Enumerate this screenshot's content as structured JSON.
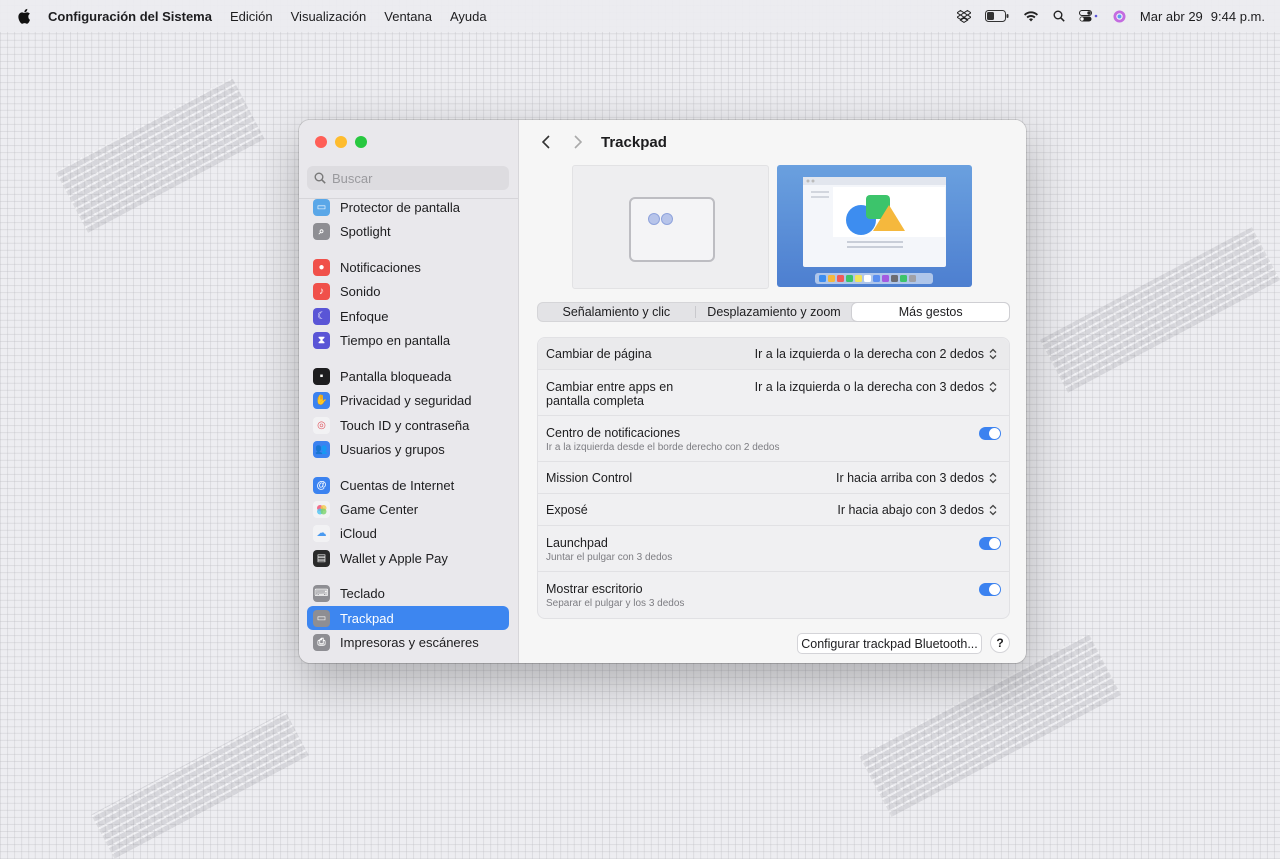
{
  "menubar": {
    "app_name": "Configuración del Sistema",
    "items": [
      "Edición",
      "Visualización",
      "Ventana",
      "Ayuda"
    ],
    "date": "Mar abr 29",
    "time": "9:44 p.m."
  },
  "search": {
    "placeholder": "Buscar"
  },
  "sidebar": {
    "items": [
      {
        "label": "Protector de pantalla",
        "icon": "screensaver-icon",
        "color": "#5aa7e8"
      },
      {
        "label": "Spotlight",
        "icon": "spotlight-icon",
        "color": "#8e8e93"
      },
      {
        "label": "Notificaciones",
        "icon": "notifications-icon",
        "color": "#f0504a"
      },
      {
        "label": "Sonido",
        "icon": "sound-icon",
        "color": "#f0504a"
      },
      {
        "label": "Enfoque",
        "icon": "focus-icon",
        "color": "#5a55d6"
      },
      {
        "label": "Tiempo en pantalla",
        "icon": "screen-time-icon",
        "color": "#5a55d6"
      },
      {
        "label": "Pantalla bloqueada",
        "icon": "lock-screen-icon",
        "color": "#1d1d1f"
      },
      {
        "label": "Privacidad y seguridad",
        "icon": "privacy-hand-icon",
        "color": "#3b82f0"
      },
      {
        "label": "Touch ID y contraseña",
        "icon": "fingerprint-icon",
        "color": "#f2f2f4"
      },
      {
        "label": "Usuarios y grupos",
        "icon": "users-icon",
        "color": "#3b82f0"
      },
      {
        "label": "Cuentas de Internet",
        "icon": "at-icon",
        "color": "#3b82f0"
      },
      {
        "label": "Game Center",
        "icon": "game-center-icon",
        "color": "#f2f2f4"
      },
      {
        "label": "iCloud",
        "icon": "icloud-icon",
        "color": "#f2f2f4"
      },
      {
        "label": "Wallet y Apple Pay",
        "icon": "wallet-icon",
        "color": "#2a2a2a"
      },
      {
        "label": "Teclado",
        "icon": "keyboard-icon",
        "color": "#8e8e93"
      },
      {
        "label": "Trackpad",
        "icon": "trackpad-icon",
        "color": "#8e8e93"
      },
      {
        "label": "Impresoras y escáneres",
        "icon": "printer-icon",
        "color": "#8e8e93"
      }
    ],
    "selected": "Trackpad"
  },
  "main": {
    "title": "Trackpad",
    "tabs": [
      "Señalamiento y clic",
      "Desplazamiento y zoom",
      "Más gestos"
    ],
    "active_tab": "Más gestos",
    "rows": [
      {
        "label": "Cambiar de página",
        "value": "Ir a la izquierda o la derecha con 2 dedos"
      },
      {
        "label": "Cambiar entre apps en",
        "label2": "pantalla completa",
        "value": "Ir a la izquierda o la derecha con 3 dedos"
      },
      {
        "label": "Centro de notificaciones",
        "sub": "Ir a la izquierda desde el borde derecho con 2 dedos",
        "toggle": true
      },
      {
        "label": "Mission Control",
        "value": "Ir hacia arriba con 3 dedos"
      },
      {
        "label": "Exposé",
        "value": "Ir hacia abajo con 3 dedos"
      },
      {
        "label": "Launchpad",
        "sub": "Juntar el pulgar con 3 dedos",
        "toggle": true
      },
      {
        "label": "Mostrar escritorio",
        "sub": "Separar el pulgar y los 3 dedos",
        "toggle": true
      }
    ],
    "bluetooth_button": "Configurar trackpad Bluetooth...",
    "help_button": "?"
  },
  "colors": {
    "accent": "#3d86f0",
    "toggle_on": "#3b82f0"
  }
}
